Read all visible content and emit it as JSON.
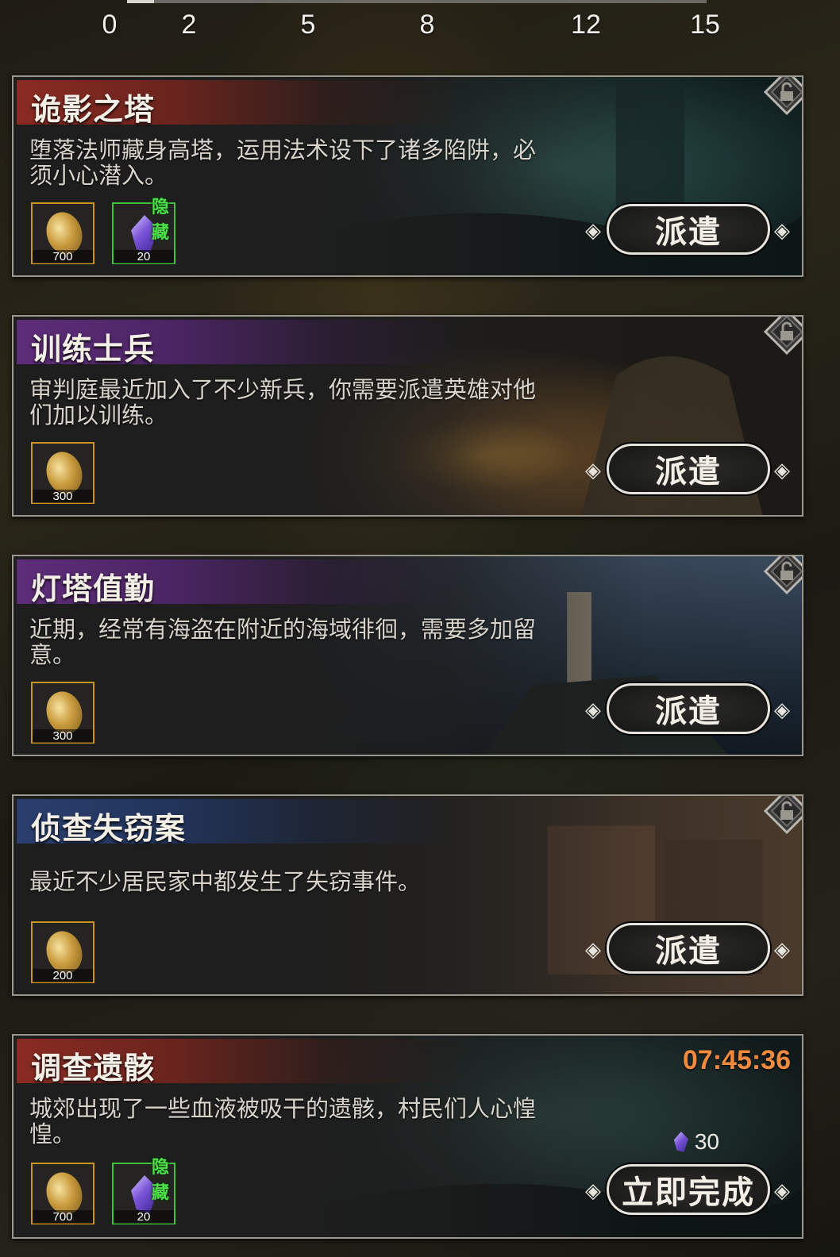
{
  "scale": [
    "0",
    "2",
    "5",
    "8",
    "12",
    "15"
  ],
  "colors": {
    "gold_border": "#c9941f",
    "green_border": "#3fbf3a",
    "timer": "#f08a3c",
    "hidden_tag": "#4ee04a"
  },
  "missions": [
    {
      "title": "诡影之塔",
      "title_color": "red",
      "description": "堕落法师藏身高塔，运用法术设下了诸多陷阱，必须小心潜入。",
      "rewards": [
        {
          "icon": "gold-coin-icon",
          "amount": "700"
        },
        {
          "icon": "purple-crystal-icon",
          "amount": "20",
          "tag": "隐藏"
        }
      ],
      "button": "派遣",
      "locked": true
    },
    {
      "title": "训练士兵",
      "title_color": "purple",
      "description": "审判庭最近加入了不少新兵，你需要派遣英雄对他们加以训练。",
      "rewards": [
        {
          "icon": "gold-coin-icon",
          "amount": "300"
        }
      ],
      "button": "派遣",
      "locked": true
    },
    {
      "title": "灯塔值勤",
      "title_color": "purple",
      "description": "近期，经常有海盗在附近的海域徘徊，需要多加留意。",
      "rewards": [
        {
          "icon": "gold-coin-icon",
          "amount": "300"
        }
      ],
      "button": "派遣",
      "locked": true
    },
    {
      "title": "侦查失窃案",
      "title_color": "blue",
      "description": "最近不少居民家中都发生了失窃事件。",
      "rewards": [
        {
          "icon": "gold-coin-icon",
          "amount": "200"
        }
      ],
      "button": "派遣",
      "locked": true
    },
    {
      "title": "调查遗骸",
      "title_color": "red",
      "description": "城郊出现了一些血液被吸干的遗骸，村民们人心惶惶。",
      "rewards": [
        {
          "icon": "gold-coin-icon",
          "amount": "700"
        },
        {
          "icon": "purple-crystal-icon",
          "amount": "20",
          "tag": "隐藏"
        }
      ],
      "timer": "07:45:36",
      "cost": "30",
      "button": "立即完成",
      "locked": false
    }
  ]
}
